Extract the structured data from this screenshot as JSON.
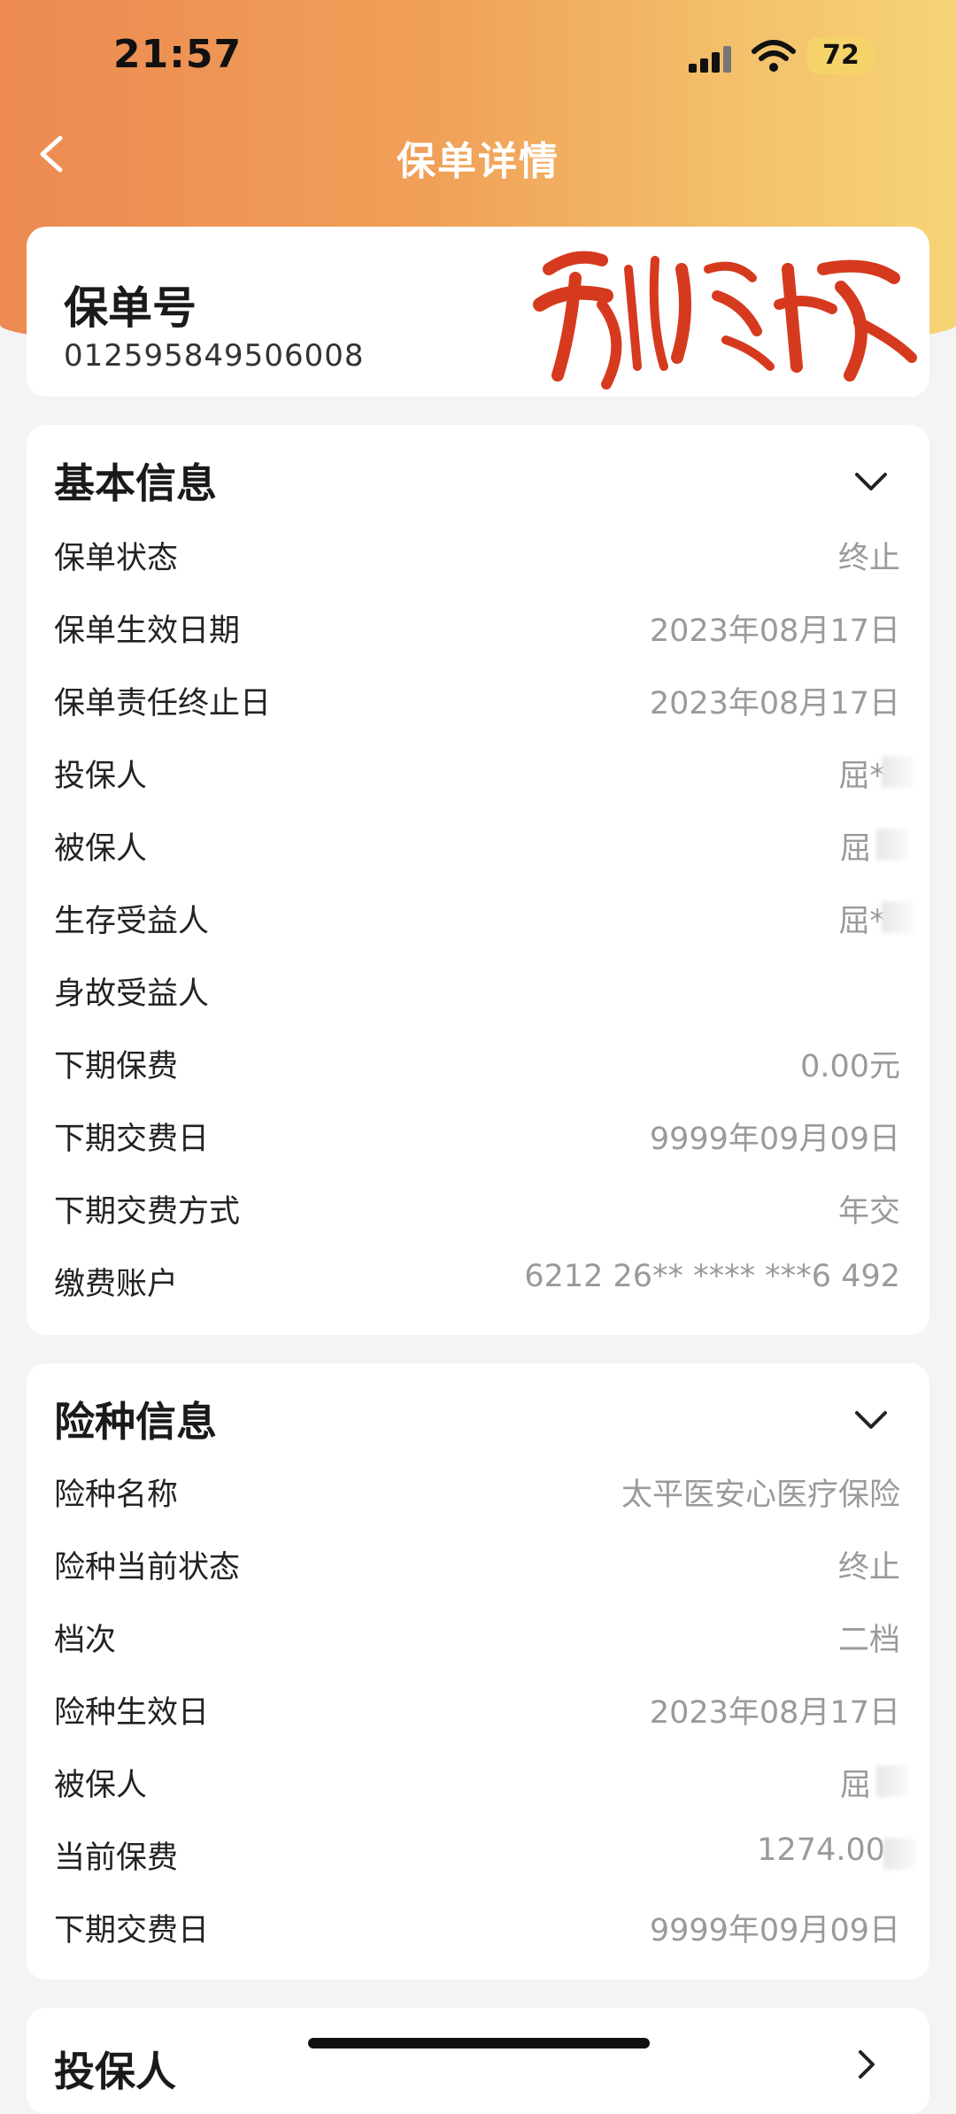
{
  "status_bar": {
    "time": "21:57",
    "battery": "72"
  },
  "nav": {
    "title": "保单详情"
  },
  "policy": {
    "label": "保单号",
    "number": "012595849506008"
  },
  "basic_info": {
    "title": "基本信息",
    "rows": [
      {
        "label": "保单状态",
        "value": "终止"
      },
      {
        "label": "保单生效日期",
        "value": "2023年08月17日"
      },
      {
        "label": "保单责任终止日",
        "value": "2023年08月17日"
      },
      {
        "label": "投保人",
        "value": "屈*"
      },
      {
        "label": "被保人",
        "value": "屈"
      },
      {
        "label": "生存受益人",
        "value": "屈*"
      },
      {
        "label": "身故受益人",
        "value": ""
      },
      {
        "label": "下期保费",
        "value": "0.00元"
      },
      {
        "label": "下期交费日",
        "value": "9999年09月09日"
      },
      {
        "label": "下期交费方式",
        "value": "年交"
      },
      {
        "label": "缴费账户",
        "value": "6212 26** **** ***6 492"
      }
    ]
  },
  "insurance_info": {
    "title": "险种信息",
    "rows": [
      {
        "label": "险种名称",
        "value": "太平医安心医疗保险"
      },
      {
        "label": "险种当前状态",
        "value": "终止"
      },
      {
        "label": "档次",
        "value": "二档"
      },
      {
        "label": "险种生效日",
        "value": "2023年08月17日"
      },
      {
        "label": "被保人",
        "value": "屈"
      },
      {
        "label": "当前保费",
        "value": "1274.00"
      },
      {
        "label": "下期交费日",
        "value": "9999年09月09日"
      }
    ]
  },
  "applicant": {
    "title": "投保人"
  }
}
